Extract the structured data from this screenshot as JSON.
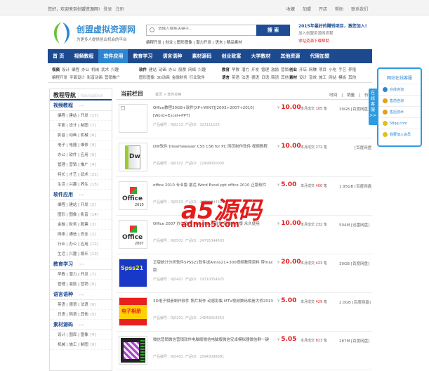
{
  "topbar": {
    "welcome": "您好，欢迎来到创盟资源网!",
    "login": "登录",
    "register": "注册",
    "links": [
      "收藏",
      "加盟",
      "开店",
      "帮助",
      "联系我们"
    ]
  },
  "logo": {
    "name": "创盟虚拟资源网",
    "slogan": "为更多人提供创业机会的平台"
  },
  "search": {
    "placeholder": "请输入搜索关键字...",
    "button": "搜 索",
    "hot": "编程开发 | 创业 | 图形图像 | 潜力开发 | 语言 | 精品素材"
  },
  "promo": {
    "headline": "2015年最好的赚钱项目，激您加入!",
    "join": "加入创盟资源网流程",
    "help": "求站资源下载帮助"
  },
  "nav": [
    "首 页",
    "视频教程",
    "软件应用",
    "教育学习",
    "语言语种",
    "素材源码",
    "创业致富",
    "大学教材",
    "其他资源",
    "代理加盟"
  ],
  "nav_active": 2,
  "subnav": [
    {
      "lines": [
        {
          "head": "视频",
          "items": [
            "设计",
            "编程",
            "办公",
            "机械",
            "武术",
            "兴趣"
          ]
        },
        {
          "head": "",
          "items": [
            "编程开发",
            "平面设计",
            "影音动画",
            "营销推广"
          ]
        }
      ]
    },
    {
      "lines": [
        {
          "head": "软件",
          "items": [
            "建站",
            "动画",
            "办公",
            "股票",
            "网络",
            "兴趣"
          ]
        },
        {
          "head": "",
          "items": [
            "图形图像",
            "3D动画",
            "金融财务",
            "行业软件"
          ]
        }
      ]
    },
    {
      "lines": [
        {
          "head": "教育",
          "items": [
            "早教",
            "潜力",
            "开发",
            "管理",
            "激励",
            "营销"
          ]
        },
        {
          "head": "语言",
          "items": [
            "英语",
            "法语",
            "德语",
            "日语",
            "韩语",
            "其他"
          ]
        }
      ]
    },
    {
      "lines": [
        {
          "head": "创业",
          "items": [
            "开店",
            "网赚",
            "项目",
            "小吃",
            "手艺",
            "养殖"
          ]
        },
        {
          "head": "素材",
          "items": [
            "设计",
            "音效",
            "施工",
            "网站",
            "模板",
            "其他"
          ]
        }
      ]
    }
  ],
  "sidebar": {
    "title": "教程导航",
    "subtitle": "/ Navigation",
    "more": ">>",
    "sections": [
      {
        "name": "视频教程",
        "rows": [
          [
            "编程 | 建站 | 开发",
            "[17]"
          ],
          [
            "平面 | 设计 | 制图",
            "[7]"
          ],
          [
            "影音 | 动画 | 机械",
            "[6]"
          ],
          [
            "电子 | 电器 | 维修",
            "[9]"
          ],
          [
            "办公 | 软件 | 应用",
            "[6]"
          ],
          [
            "管理 | 营销 | 推广",
            "[4]"
          ],
          [
            "特长 | 才艺 | 武术",
            "[21]"
          ],
          [
            "生活 | 兴趣 | 养生",
            "[15]"
          ]
        ]
      },
      {
        "name": "软件应用",
        "rows": [
          [
            "编程 | 建站 | 开发",
            "[2]"
          ],
          [
            "图形 | 图像 | 影音",
            "[14]"
          ],
          [
            "金融 | 财务 | 股票",
            "[3]"
          ],
          [
            "网络 | 通信 | 安全",
            "[2]"
          ],
          [
            "行业 | 办公 | 应用",
            "[12]"
          ],
          [
            "生活 | 兴趣 | 娱乐",
            "[13]"
          ]
        ]
      },
      {
        "name": "教育学习",
        "rows": [
          [
            "早教 | 潜力 | 开发",
            "[7]"
          ],
          [
            "管理 | 激励 | 营销",
            "[0]"
          ]
        ]
      },
      {
        "name": "语言语种",
        "rows": [
          [
            "英语 | 德语 | 法语",
            "[6]"
          ],
          [
            "日语 | 韩语 | 其他",
            "[5]"
          ]
        ]
      },
      {
        "name": "素材源码",
        "rows": [
          [
            "设计 | 图库 | 图像",
            "[4]"
          ],
          [
            "机械 | 施工 | 制图",
            "[0]"
          ]
        ]
      }
    ]
  },
  "main": {
    "title": "当前栏目",
    "breadcrumb": "首页 > 软件应用",
    "sort": [
      "时间",
      "|",
      "销量",
      "|",
      "价格"
    ],
    "currency": "¥",
    "code_label": "产品编号：",
    "id_label": "产品ID：",
    "sales_prefix": "本月成交",
    "sales_suffix": "笔",
    "items": [
      {
        "title": "Office教程30GB+软件[XP+WIN7][2003+2007+2010][Word+Excel+PPT]",
        "code": "RJ0213",
        "id": "323111165",
        "price": "10.00",
        "sales": "105",
        "size": "30GB",
        "disk": "[百度网盘]",
        "thumb": "broken"
      },
      {
        "title": "DW软件 Dreamweaver CS5 CS6 for PC 网页制作软件 视频教程",
        "code": "RJ0102",
        "id": "22498000000",
        "price": "10.00",
        "sales": "272",
        "size": "",
        "disk": "[百度网盘]",
        "thumb": "dw"
      },
      {
        "title": "office 2010 专业版 激活 Word Excel ppt office 2010 正版软件",
        "code": "RJ0503",
        "id": "24795344603",
        "price": "5.00",
        "sales": "400",
        "size": "1.95GB",
        "disk": "[百度网盘]",
        "thumb": "office2010"
      },
      {
        "title": "Office 2007 办公软件 Word Excel软件 简体中文版 永久使用",
        "code": "RJ0502",
        "id": "24795344603",
        "price": "10.00",
        "sales": "232",
        "size": "504M",
        "disk": "[迅雷网盘]",
        "thumb": "office2007"
      },
      {
        "title": "正版统计分析软件SPSS21软件送Amos21+300视频教程资料 带mac版",
        "code": "RJ0402",
        "id": "19310054925",
        "price": "20.00",
        "sales": "423",
        "size": "30GB",
        "disk": "[百度网盘]",
        "thumb": "spss"
      },
      {
        "title": "3D电子相册制作软件 照片制作 动感影集 MTV视频数码相册大师2013",
        "code": "RJ0201",
        "id": "24848018353",
        "price": "5.00",
        "sales": "429",
        "size": "2.0GB",
        "disk": "[百度网盘]",
        "thumb": "album"
      },
      {
        "title": "微信营销微信营销软件电脑版微信电脑版微信安卓模拟器微信群一键",
        "code": "RJ0401",
        "id": "20943098891",
        "price": "5.05",
        "sales": "823",
        "size": "287M",
        "disk": "[百度网盘]",
        "thumb": "wechat"
      }
    ]
  },
  "thumbs": {
    "dw": "Dw",
    "office": "Office",
    "office2010": "2010",
    "office2007": "2007",
    "spss": "Spss21",
    "album": "电子相册"
  },
  "float": {
    "title": "网站在线客服",
    "tab": [
      "在",
      "线",
      "客",
      "服",
      ">>"
    ],
    "items": [
      {
        "label": "在线咨询",
        "color": "#2e86d0"
      },
      {
        "label": "售前咨询",
        "color": "#e0a020"
      },
      {
        "label": "售后技术",
        "color": "#e0a020"
      },
      {
        "label": "58qq.com",
        "color": "#e0c020"
      },
      {
        "label": "我要加入会员",
        "color": "#e0c020"
      }
    ]
  },
  "watermark": {
    "brand": "a5源码",
    "url": "admin5.com"
  }
}
